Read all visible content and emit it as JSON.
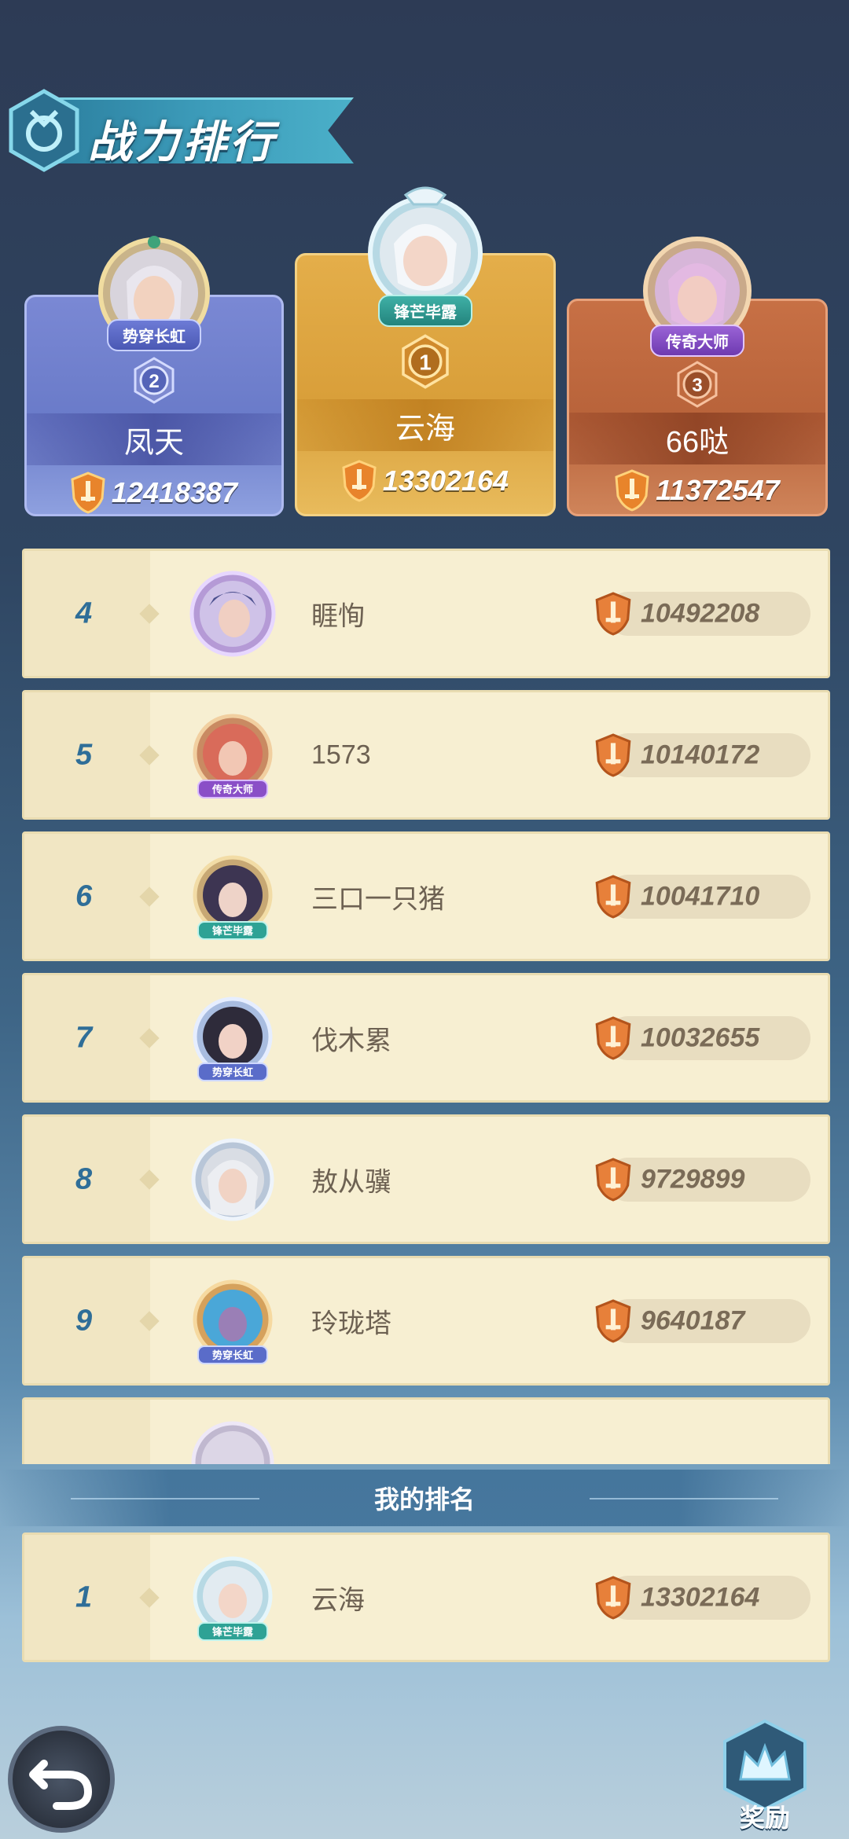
{
  "header": {
    "title": "战力排行"
  },
  "top3": [
    {
      "rank": "2",
      "name": "凤天",
      "power": "12418387",
      "badge": "势穿长虹"
    },
    {
      "rank": "1",
      "name": "云海",
      "power": "13302164",
      "badge": "锋芒毕露"
    },
    {
      "rank": "3",
      "name": "66哒",
      "power": "11372547",
      "badge": "传奇大师"
    }
  ],
  "list": [
    {
      "rank": "4",
      "name": "睚恂",
      "power": "10492208",
      "badge": ""
    },
    {
      "rank": "5",
      "name": "1573",
      "power": "10140172",
      "badge": "传奇大师"
    },
    {
      "rank": "6",
      "name": "三口一只猪",
      "power": "10041710",
      "badge": "锋芒毕露"
    },
    {
      "rank": "7",
      "name": "伐木累",
      "power": "10032655",
      "badge": "势穿长虹"
    },
    {
      "rank": "8",
      "name": "敖从骥",
      "power": "9729899",
      "badge": ""
    },
    {
      "rank": "9",
      "name": "玲珑塔",
      "power": "9640187",
      "badge": "势穿长虹"
    }
  ],
  "my_rank": {
    "label": "我的排名",
    "rank": "1",
    "name": "云海",
    "power": "13302164",
    "badge": "锋芒毕露"
  },
  "buttons": {
    "back_icon": "undo-arrow-icon",
    "reward_label": "奖励"
  },
  "colors": {
    "gold": "#d99f3a",
    "silver": "#6a7bc9",
    "bronze": "#b8633a",
    "list_bg": "#f7efd2",
    "rank_text": "#2f6e98"
  }
}
